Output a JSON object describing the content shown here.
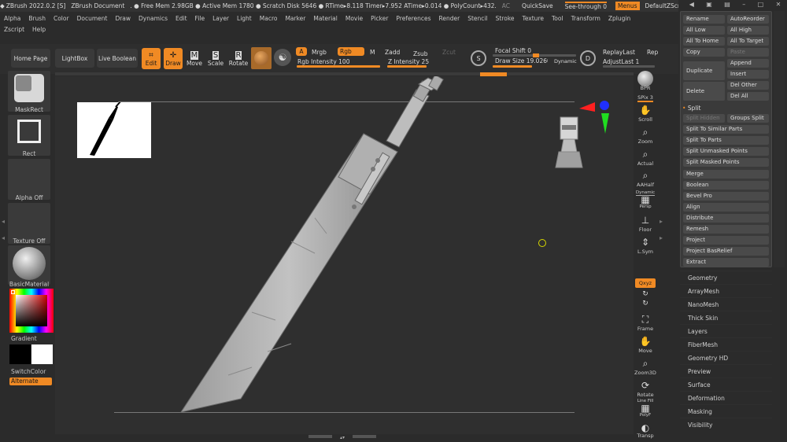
{
  "titlebar": {
    "app": "ZBrush 2022.0.2 [S]",
    "doc": "ZBrush Document",
    "stats": ". ● Free Mem 2.98GB ● Active Mem 1780 ● Scratch Disk 5646 ● RTime▸8.118 Timer▸7.952 ATime▸0.014 ● PolyCount▸432.",
    "ac": "AC",
    "quicksave": "QuickSave",
    "seethrough": "See-through  0",
    "menus": "Menus",
    "zscript": "DefaultZScript"
  },
  "menus": [
    "Alpha",
    "Brush",
    "Color",
    "Document",
    "Draw",
    "Dynamics",
    "Edit",
    "File",
    "Layer",
    "Light",
    "Macro",
    "Marker",
    "Material",
    "Movie",
    "Picker",
    "Preferences",
    "Render",
    "Stencil",
    "Stroke",
    "Texture",
    "Tool",
    "Transform",
    "Zplugin"
  ],
  "menus2": [
    "Zscript",
    "Help"
  ],
  "toolbar": {
    "home": "Home Page",
    "lightbox": "LightBox",
    "liveboolean": "Live Boolean",
    "edit": "Edit",
    "draw": "Draw",
    "move": "Move",
    "scale": "Scale",
    "rotate": "Rotate",
    "a": "A",
    "mrgb": "Mrgb",
    "rgb": "Rgb",
    "m": "M",
    "rgb_intensity": "Rgb Intensity 100",
    "zadd": "Zadd",
    "zsub": "Zsub",
    "zcut": "Zcut",
    "z_intensity": "Z Intensity 25",
    "focal_shift": "Focal Shift 0",
    "draw_size": "Draw Size 19.02606",
    "dynamic": "Dynamic",
    "replaylast": "ReplayLast",
    "rep": "Rep",
    "adjustlast": "AdjustLast 1",
    "s_label": "S",
    "d_label": "D"
  },
  "leftshelf": {
    "brush": "MaskRect",
    "stroke": "Rect",
    "alpha": "Alpha Off",
    "texture": "Texture Off",
    "material": "BasicMaterial",
    "gradient": "Gradient",
    "switchcolor": "SwitchColor",
    "alternate": "Alternate"
  },
  "rightshelf": [
    "BPR",
    "SPix 3",
    "Scroll",
    "Zoom",
    "Actual",
    "AAHalf",
    "Dynamic",
    "Persp",
    "Floor",
    "L.Sym",
    "Qxyz",
    "Frame",
    "Move",
    "Zoom3D",
    "Rotate",
    "Line Fill",
    "PolyF",
    "Transp"
  ],
  "subtool_palette": {
    "row1": [
      "Rename",
      "AutoReorder"
    ],
    "row2": [
      "All Low",
      "All High"
    ],
    "row3": [
      "All To Home",
      "All To Target"
    ],
    "row4": [
      "Copy",
      "Paste"
    ],
    "duplicate": "Duplicate",
    "append": "Append",
    "insert": "Insert",
    "delete": "Delete",
    "delother": "Del Other",
    "delall": "Del All",
    "split": "Split",
    "split_hidden": "Split Hidden",
    "groups_split": "Groups Split",
    "split_similar": "Split To Similar Parts",
    "split_parts": "Split To Parts",
    "split_unmasked": "Split Unmasked Points",
    "split_masked": "Split Masked Points",
    "merge": "Merge",
    "boolean": "Boolean",
    "bevelpro": "Bevel Pro",
    "align": "Align",
    "distribute": "Distribute",
    "remesh": "Remesh",
    "project": "Project",
    "project_bas": "Project BasRelief",
    "extract": "Extract"
  },
  "tool_palette": [
    "Geometry",
    "ArrayMesh",
    "NanoMesh",
    "Thick Skin",
    "Layers",
    "FiberMesh",
    "Geometry HD",
    "Preview",
    "Surface",
    "Deformation",
    "Masking",
    "Visibility"
  ],
  "colors": {
    "accent": "#f08a24",
    "bg": "#2b2b2b",
    "canvas": "#2f2f2f"
  }
}
